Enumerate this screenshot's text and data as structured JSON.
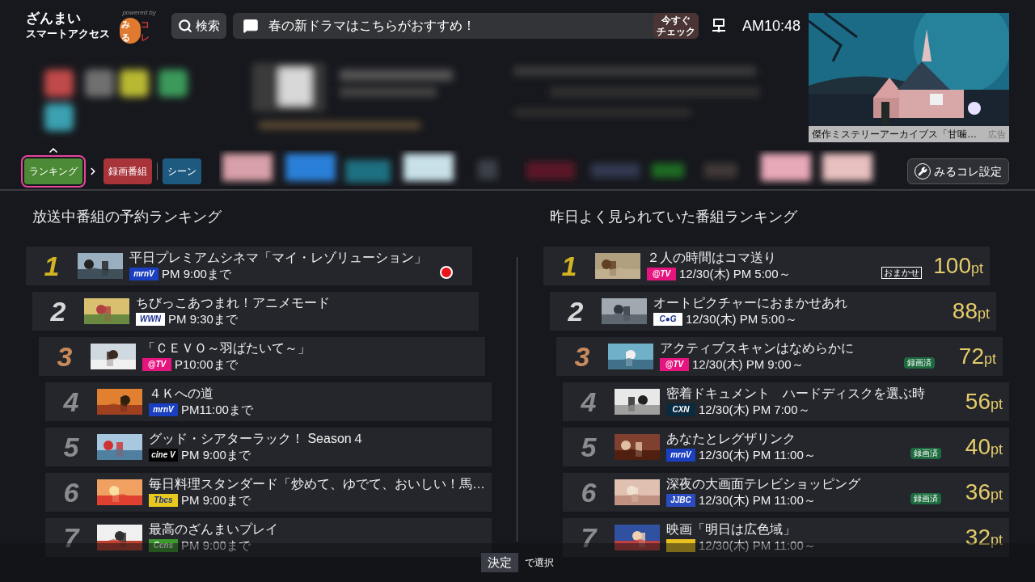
{
  "header": {
    "logo_lines": [
      "ざんまい",
      "スマートアクセス"
    ],
    "powered_by": "powered by",
    "brand": {
      "part_1": "みる",
      "part_2": "コレ"
    },
    "search_button": "検索",
    "message": "春の新ドラマはこちらがおすすめ！",
    "check_badge": [
      "今すぐ",
      "チェック"
    ],
    "clock": "AM10:48"
  },
  "ad": {
    "caption": "傑作ミステリーアーカイブス「甘噛…",
    "label": "広告"
  },
  "tabs": [
    {
      "label": "ランキング",
      "selected": true,
      "color": "#4c8a36"
    },
    {
      "label": "録画番組",
      "selected": false,
      "color": "#a8343a"
    },
    {
      "label": "シーン",
      "selected": false,
      "color": "#1e5a80"
    }
  ],
  "settings_button": "みるコレ設定",
  "left": {
    "title": "放送中番組の予約ランキング",
    "rows": [
      {
        "rank": "1",
        "title": "平日プレミアムシネマ「マイ・レゾリューション」",
        "logo": {
          "text": "mrnV",
          "color": "#1a3fc0"
        },
        "time": "PM 9:00まで",
        "reserved": true
      },
      {
        "rank": "2",
        "title": "ちびっこあつまれ！アニメモード",
        "logo": {
          "text": "WWN",
          "color": "#ffffff"
        },
        "time": "PM 9:30まで",
        "reserved": false
      },
      {
        "rank": "3",
        "title": "「ＣＥＶＯ～羽ばたいて～」",
        "logo": {
          "text": "@TV",
          "color": "#e6147f"
        },
        "time": "P10:00まで",
        "reserved": false
      },
      {
        "rank": "4",
        "title": "４Ｋへの道",
        "logo": {
          "text": "mrnV",
          "color": "#1a3fc0"
        },
        "time": "PM11:00まで",
        "reserved": false
      },
      {
        "rank": "5",
        "title": "グッド・シアターラック！ Season４",
        "logo": {
          "text": "cine V",
          "color": "#000000"
        },
        "time": "PM 9:00まで",
        "reserved": false
      },
      {
        "rank": "6",
        "title": "毎日料理スタンダード「炒めて、ゆでて、おいしい！馬…",
        "logo": {
          "text": "Tbcs",
          "color": "#e8c81c"
        },
        "time": "PM 9:00まで",
        "reserved": false
      },
      {
        "rank": "7",
        "title": "最高のざんまいプレイ",
        "logo": {
          "text": "Ccns",
          "color": "#3c9a2c"
        },
        "time": "PM 9:00まで",
        "reserved": false
      }
    ]
  },
  "right": {
    "title": "昨日よく見られていた番組ランキング",
    "rows": [
      {
        "rank": "1",
        "title": "２人の時間はコマ送り",
        "logo": {
          "text": "@TV",
          "color": "#e6147f"
        },
        "time": "12/30(木) PM 5:00～",
        "badge": {
          "kind": "omakase",
          "text": "おまかせ"
        },
        "score": "100",
        "unit": "pt"
      },
      {
        "rank": "2",
        "title": "オートピクチャーにおまかせあれ",
        "logo": {
          "text": "C●G",
          "color": "#ffffff"
        },
        "time": "12/30(木) PM 5:00～",
        "score": "88",
        "unit": "pt"
      },
      {
        "rank": "3",
        "title": "アクティブスキャンはなめらかに",
        "logo": {
          "text": "@TV",
          "color": "#e6147f"
        },
        "time": "12/30(木) PM 9:00～",
        "badge": {
          "kind": "recorded",
          "text": "録画済"
        },
        "score": "72",
        "unit": "pt"
      },
      {
        "rank": "4",
        "title": "密着ドキュメント　ハードディスクを選ぶ時",
        "logo": {
          "text": "CXN",
          "color": "#0a2a40"
        },
        "time": "12/30(木) PM 7:00～",
        "score": "56",
        "unit": "pt"
      },
      {
        "rank": "5",
        "title": "あなたとレグザリンク",
        "logo": {
          "text": "mrnV",
          "color": "#1a3fc0"
        },
        "time": "12/30(木) PM 11:00～",
        "badge": {
          "kind": "recorded",
          "text": "録画済"
        },
        "score": "40",
        "unit": "pt"
      },
      {
        "rank": "6",
        "title": "深夜の大画面テレビショッピング",
        "logo": {
          "text": "JJBC",
          "color": "#2a4cc0"
        },
        "time": "12/30(木) PM 11:00～",
        "badge": {
          "kind": "recorded",
          "text": "録画済"
        },
        "score": "36",
        "unit": "pt"
      },
      {
        "rank": "7",
        "title": "映画「明日は広色域」",
        "logo": {
          "color": "#e8c020"
        },
        "time": "12/30(木) PM 11:00～",
        "score": "32",
        "unit": "pt"
      }
    ]
  },
  "footer": {
    "key": "決定",
    "hint": "で選択"
  }
}
